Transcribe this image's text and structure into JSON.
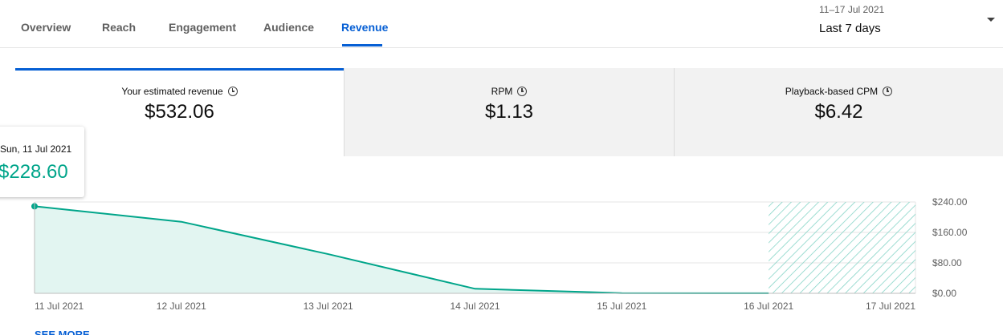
{
  "tabs": [
    {
      "label": "Overview"
    },
    {
      "label": "Reach"
    },
    {
      "label": "Engagement"
    },
    {
      "label": "Audience"
    },
    {
      "label": "Revenue"
    }
  ],
  "active_tab": "Revenue",
  "date_range": {
    "sub": "11–17 Jul 2021",
    "main": "Last 7 days"
  },
  "metrics": [
    {
      "label": "Your estimated revenue",
      "value": "$532.06"
    },
    {
      "label": "RPM",
      "value": "$1.13"
    },
    {
      "label": "Playback-based CPM",
      "value": "$6.42"
    }
  ],
  "tooltip": {
    "date": "Sun, 11 Jul 2021",
    "value": "$228.60"
  },
  "see_more": "SEE MORE",
  "colors": {
    "accent": "#065fd4",
    "series": "#00a58a",
    "fill": "#e2f5f1",
    "hatch": "#7fd2c4"
  },
  "icons": {
    "metric_info": "clock-icon",
    "date_dropdown": "caret-down-icon"
  },
  "chart_data": {
    "type": "area",
    "x": [
      "11 Jul 2021",
      "12 Jul 2021",
      "13 Jul 2021",
      "14 Jul 2021",
      "15 Jul 2021",
      "16 Jul 2021",
      "17 Jul 2021"
    ],
    "series": [
      {
        "values": [
          228.6,
          188,
          103,
          12,
          0.5,
          0.3,
          null
        ]
      }
    ],
    "y_ticks": [
      "$0.00",
      "$80.00",
      "$160.00",
      "$240.00"
    ],
    "ylim": [
      0,
      240
    ],
    "hatched_range": [
      "16 Jul 2021",
      "17 Jul 2021"
    ],
    "highlighted_point": "11 Jul 2021",
    "grid": true
  }
}
